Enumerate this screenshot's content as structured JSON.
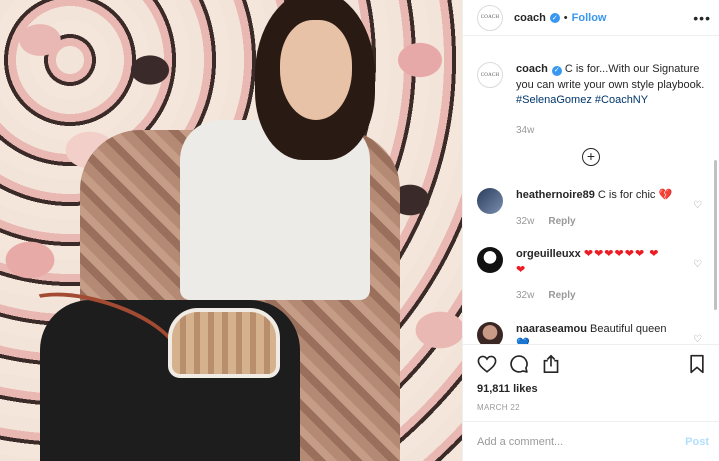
{
  "header": {
    "username": "coach",
    "verified_icon": "verified-badge-icon",
    "separator": "•",
    "follow_label": "Follow",
    "more_label": "•••",
    "avatar_text": "COACH"
  },
  "caption": {
    "username": "coach",
    "text": " C is for...With our Signature you can write your own style playbook. ",
    "tags": [
      "#SelenaGomez",
      "#CoachNY"
    ],
    "time": "34w"
  },
  "load_more_label": "+",
  "comments": [
    {
      "username": "heathernoire89",
      "text": " C is for chic ",
      "emoji": "💔",
      "time": "32w",
      "reply_label": "Reply"
    },
    {
      "username": "orgeuilleuxx",
      "text": " ",
      "emoji": "❤❤❤❤❤❤ ❤❤",
      "time": "32w",
      "reply_label": "Reply"
    },
    {
      "username": "naaraseamou",
      "text": " Beautiful queen ",
      "emoji": "💙"
    }
  ],
  "actions": {
    "likes": "91,811 likes",
    "date": "MARCH 22"
  },
  "add_comment": {
    "placeholder": "Add a comment...",
    "post_label": "Post"
  },
  "colors": {
    "accent": "#3897f0",
    "text": "#262626",
    "muted": "#999999",
    "post_disabled": "#b2dffc"
  }
}
